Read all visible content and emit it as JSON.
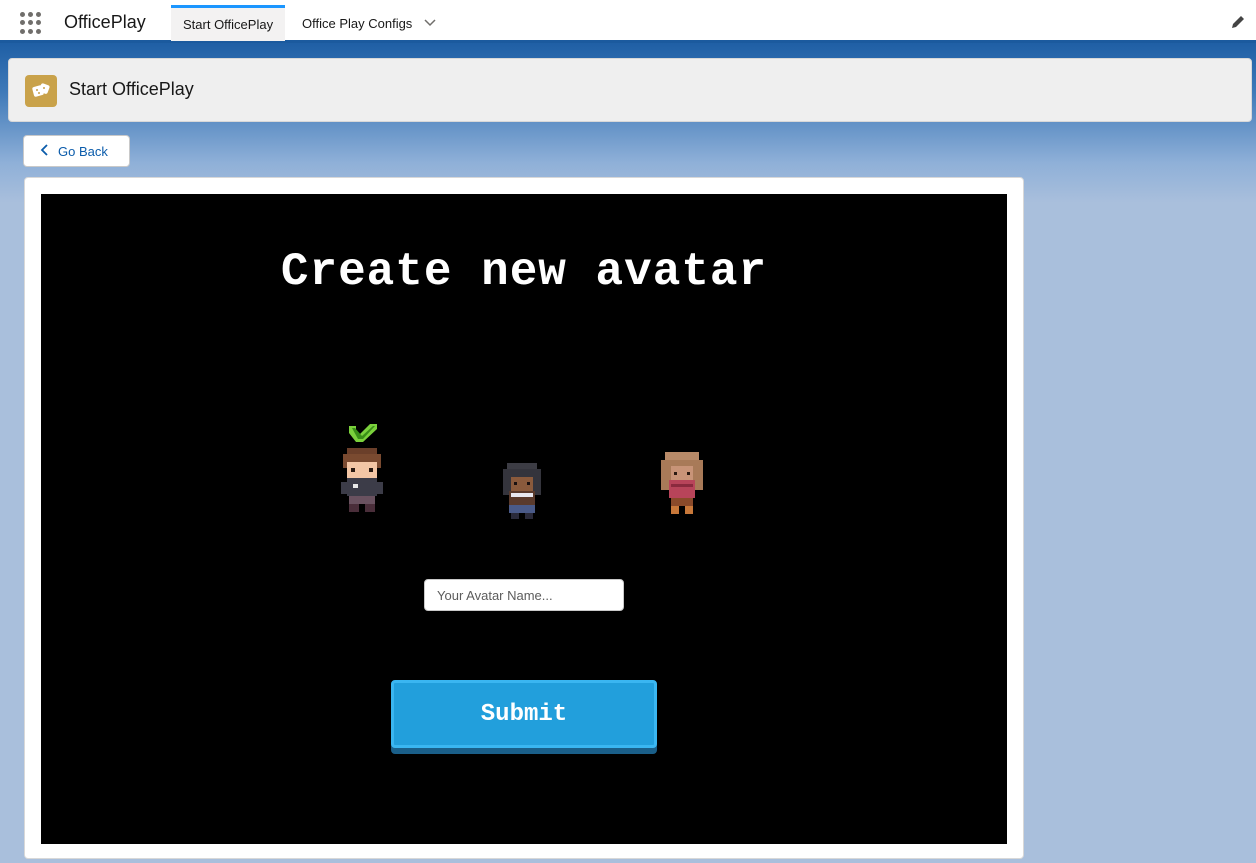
{
  "app": {
    "name": "OfficePlay"
  },
  "nav": {
    "tabs": [
      {
        "label": "Start OfficePlay",
        "active": true
      },
      {
        "label": "Office Play Configs",
        "active": false
      }
    ]
  },
  "header": {
    "title": "Start OfficePlay",
    "icon": "dice-icon"
  },
  "actions": {
    "go_back_label": "Go Back"
  },
  "game": {
    "title": "Create new avatar",
    "avatars": [
      {
        "name": "avatar-option-1",
        "selected": true
      },
      {
        "name": "avatar-option-2",
        "selected": false
      },
      {
        "name": "avatar-option-3",
        "selected": false
      }
    ],
    "name_input": {
      "placeholder": "Your Avatar Name...",
      "value": ""
    },
    "submit_label": "Submit"
  },
  "colors": {
    "accent": "#1b96ff",
    "nav_border": "#1b5a9e",
    "submit_bg": "#229fdc",
    "check_green": "#7bd13c"
  }
}
